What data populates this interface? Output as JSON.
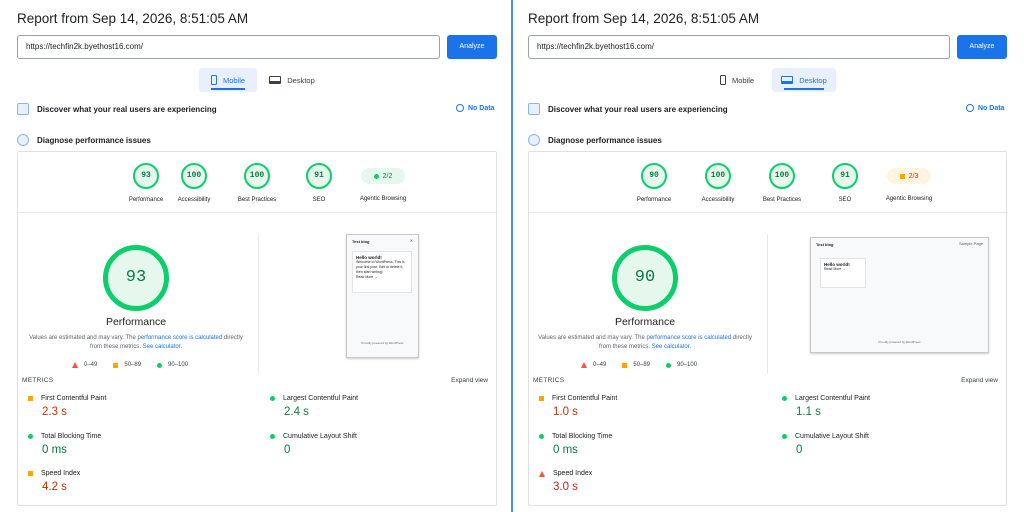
{
  "report_title": "Report from Sep 14, 2026, 8:51:05 AM",
  "url_value": "https://techfin2k.byethost16.com/",
  "analyze_label": "Analyze",
  "tabs": {
    "mobile": "Mobile",
    "desktop": "Desktop"
  },
  "discover_text": "Discover what your real users are experiencing",
  "no_data": "No Data",
  "diagnose_text": "Diagnose performance issues",
  "category_labels": {
    "performance": "Performance",
    "accessibility": "Accessibility",
    "best_practices": "Best Practices",
    "seo": "SEO",
    "agentic": "Agentic Browsing"
  },
  "big_label": "Performance",
  "disclaimer": {
    "pre": "Values are estimated and may vary. The ",
    "link1": "performance score is calculated",
    "mid": " directly from these metrics. ",
    "link2": "See calculator."
  },
  "legend": {
    "red": "0–49",
    "orange": "50–89",
    "green": "90–100"
  },
  "metrics_heading": "METRICS",
  "expand_view": "Expand view",
  "metric_labels": {
    "fcp": "First Contentful Paint",
    "lcp": "Largest Contentful Paint",
    "tbt": "Total Blocking Time",
    "cls": "Cumulative Layout Shift",
    "si": "Speed Index"
  },
  "thumb": {
    "blog_title": "Test blog",
    "close": "✕",
    "hello": "Hello world!",
    "body": "Welcome to WordPress. This is your first post. Edit or delete it, then start writing!",
    "more": "Read More →",
    "footer": "Proudly powered by WordPress",
    "menu": "Sample Page"
  },
  "mobile": {
    "scores": {
      "performance": "93",
      "accessibility": "100",
      "best_practices": "100",
      "seo": "91",
      "agentic": "2/2"
    },
    "big_score": "93",
    "metrics": {
      "fcp": "2.3 s",
      "lcp": "2.4 s",
      "tbt": "0 ms",
      "cls": "0",
      "si": "4.2 s"
    }
  },
  "desktop": {
    "scores": {
      "performance": "90",
      "accessibility": "100",
      "best_practices": "100",
      "seo": "91",
      "agentic": "2/3"
    },
    "big_score": "90",
    "metrics": {
      "fcp": "1.0 s",
      "lcp": "1.1 s",
      "tbt": "0 ms",
      "cls": "0",
      "si": "3.0 s"
    }
  },
  "colors": {
    "green": "#0cce6b",
    "orange": "#ffa400",
    "red": "#ff4e42",
    "blue": "#1a73e8"
  }
}
